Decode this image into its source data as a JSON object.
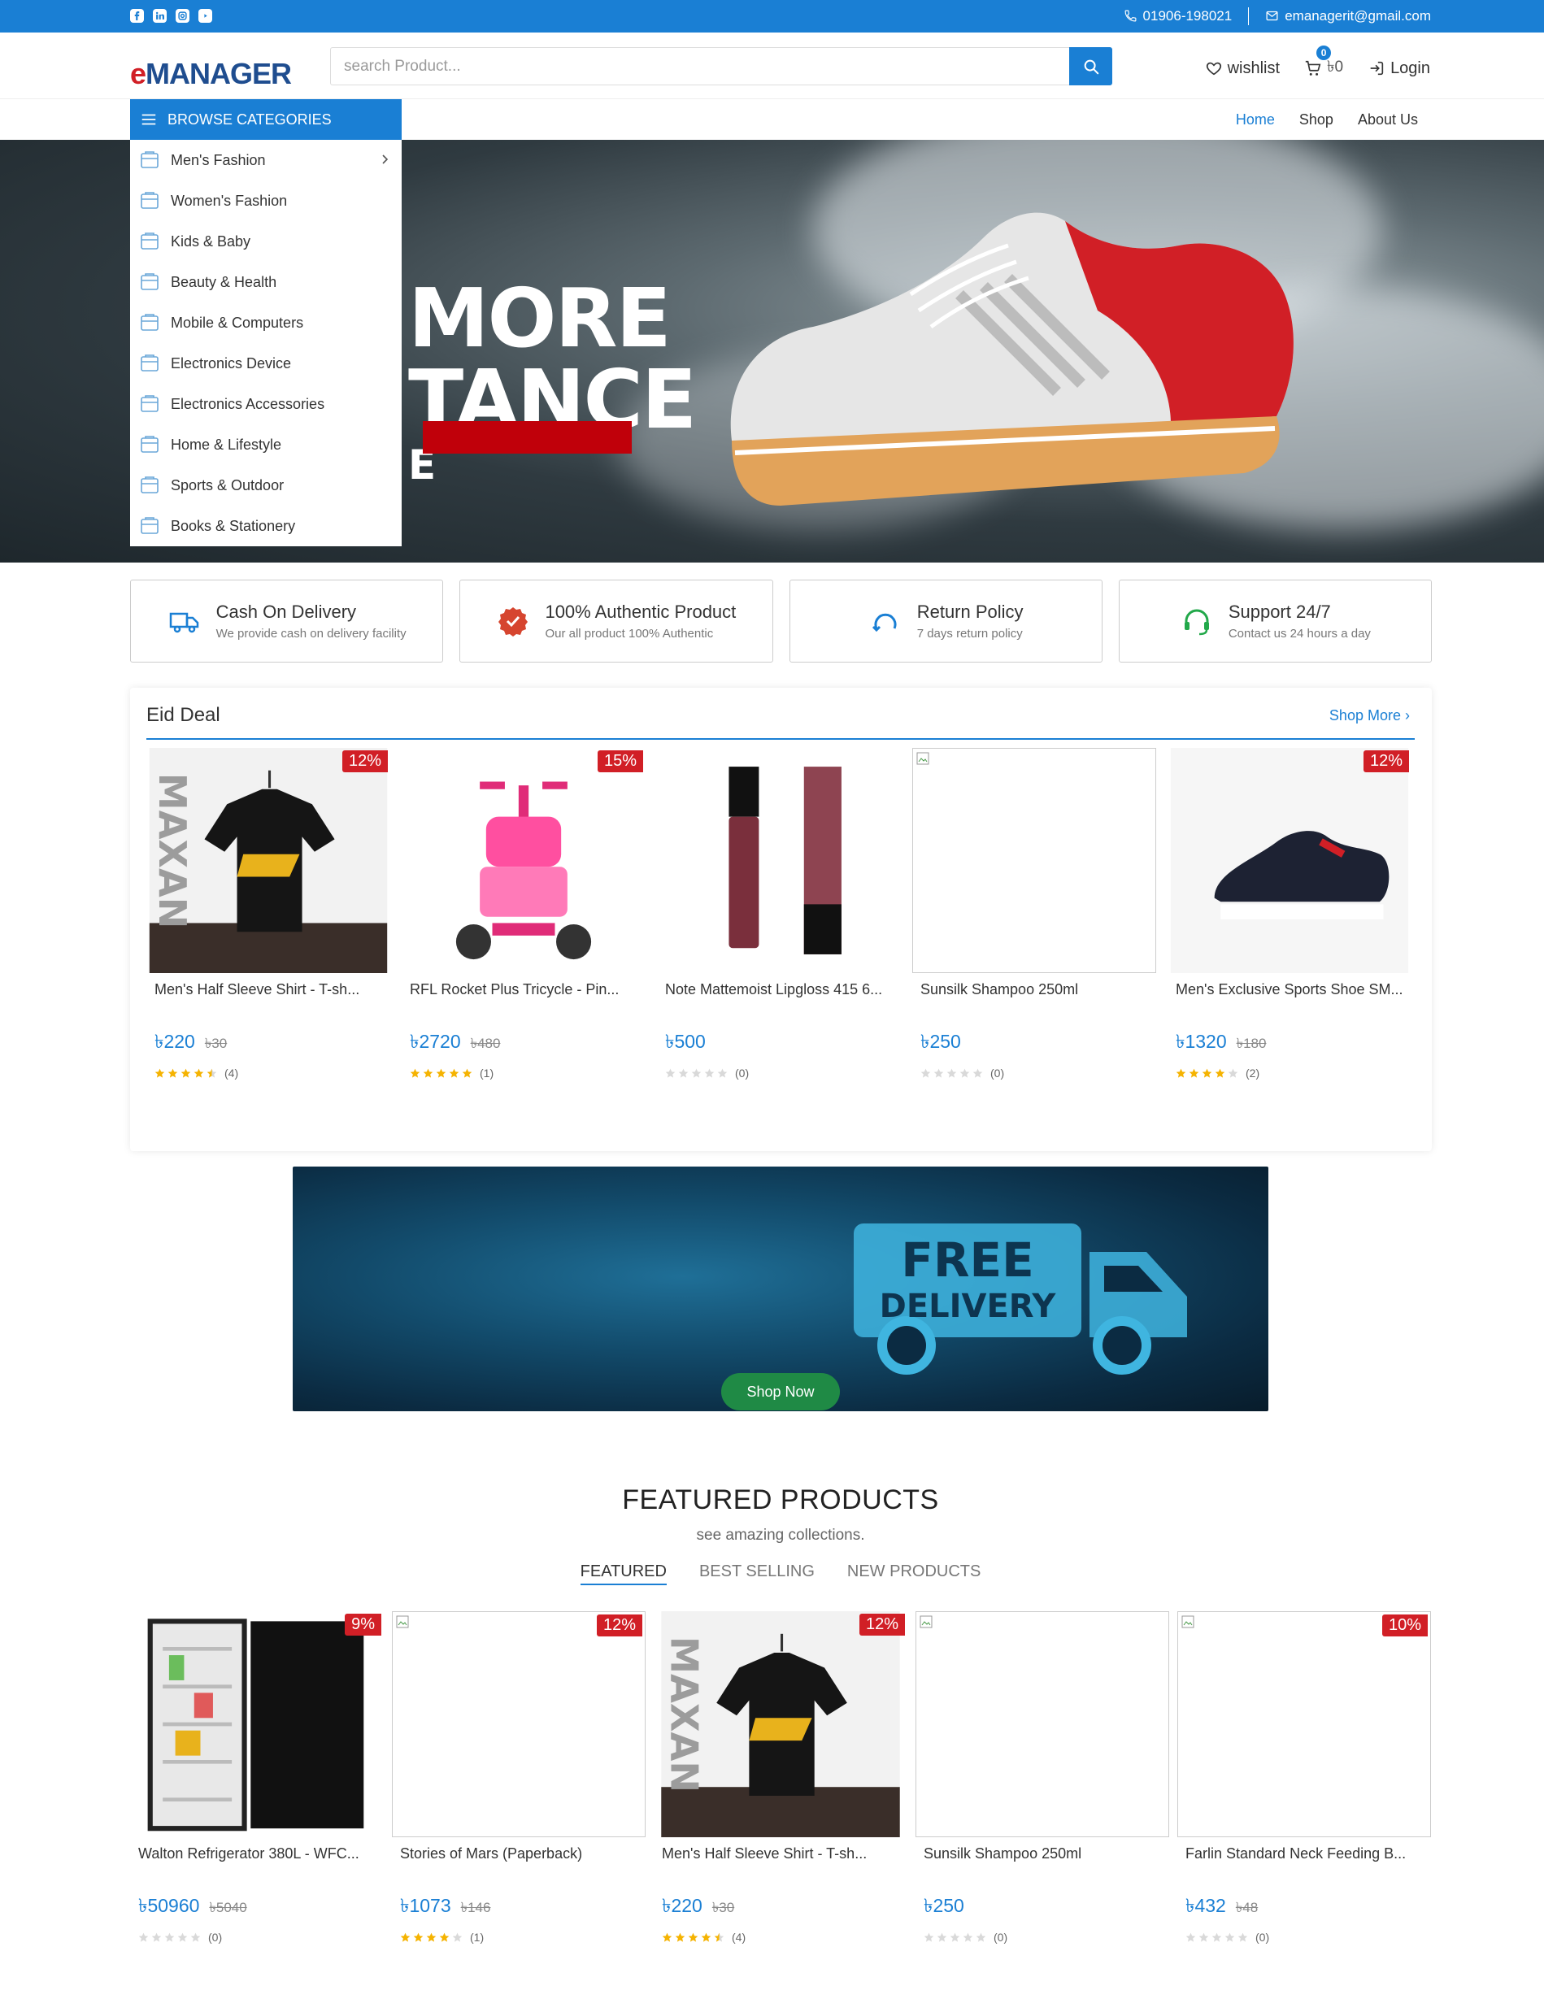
{
  "topbar": {
    "phone": "01906-198021",
    "email": "emanagerit@gmail.com",
    "social": [
      "facebook-icon",
      "linkedin-icon",
      "instagram-icon",
      "youtube-icon"
    ]
  },
  "header": {
    "logo_e": "e",
    "logo_rest": "MANAGER",
    "search_placeholder": "search Product...",
    "wishlist_label": "wishlist",
    "cart_count": "0",
    "cart_amount": "৳0",
    "login_label": "Login"
  },
  "browse": {
    "label": "BROWSE CATEGORIES"
  },
  "nav": {
    "home": "Home",
    "shop": "Shop",
    "about": "About Us"
  },
  "categories": [
    "Men's Fashion",
    "Women's Fashion",
    "Kids & Baby",
    "Beauty & Health",
    "Mobile & Computers",
    "Electronics Device",
    "Electronics Accessories",
    "Home & Lifestyle",
    "Sports & Outdoor",
    "Books & Stationery"
  ],
  "hero": {
    "line1": "MORE",
    "line2": "TANCE",
    "line3": "E"
  },
  "features": [
    {
      "title": "Cash On Delivery",
      "sub": "We provide cash on delivery facility"
    },
    {
      "title": "100% Authentic Product",
      "sub": "Our all product 100% Authentic"
    },
    {
      "title": "Return Policy",
      "sub": "7 days return policy"
    },
    {
      "title": "Support 24/7",
      "sub": "Contact us 24 hours a day"
    }
  ],
  "eid": {
    "title": "Eid Deal",
    "shop_more": "Shop More",
    "products": [
      {
        "name": "Men's Half Sleeve Shirt - T-sh...",
        "price": "৳220",
        "old": "৳30",
        "disc": "12%",
        "stars": 4.5,
        "count": "(4)"
      },
      {
        "name": "RFL Rocket Plus Tricycle - Pin...",
        "price": "৳2720",
        "old": "৳480",
        "disc": "15%",
        "stars": 5,
        "count": "(1)"
      },
      {
        "name": "Note Mattemoist Lipgloss 415 6...",
        "price": "৳500",
        "old": "",
        "disc": "",
        "stars": 0,
        "count": "(0)"
      },
      {
        "name": "Sunsilk Shampoo 250ml",
        "price": "৳250",
        "old": "",
        "disc": "",
        "stars": 0,
        "count": "(0)"
      },
      {
        "name": "Men's Exclusive Sports Shoe SM...",
        "price": "৳1320",
        "old": "৳180",
        "disc": "12%",
        "stars": 4,
        "count": "(2)"
      }
    ]
  },
  "promo": {
    "word1": "FREE",
    "word2": "DELIVERY",
    "button": "Shop Now"
  },
  "featured": {
    "title": "FEATURED PRODUCTS",
    "subtitle": "see amazing collections.",
    "tabs": [
      "FEATURED",
      "BEST SELLING",
      "NEW PRODUCTS"
    ],
    "products": [
      {
        "name": "Walton Refrigerator 380L - WFC...",
        "price": "৳50960",
        "old": "৳5040",
        "disc": "9%",
        "stars": 0,
        "count": "(0)"
      },
      {
        "name": "Stories of Mars (Paperback)",
        "price": "৳1073",
        "old": "৳146",
        "disc": "12%",
        "stars": 4,
        "count": "(1)"
      },
      {
        "name": "Men's Half Sleeve Shirt - T-sh...",
        "price": "৳220",
        "old": "৳30",
        "disc": "12%",
        "stars": 4.5,
        "count": "(4)"
      },
      {
        "name": "Sunsilk Shampoo 250ml",
        "price": "৳250",
        "old": "",
        "disc": "",
        "stars": 0,
        "count": "(0)"
      },
      {
        "name": "Farlin Standard Neck Feeding B...",
        "price": "৳432",
        "old": "৳48",
        "disc": "10%",
        "stars": 0,
        "count": "(0)"
      }
    ]
  },
  "colors": {
    "primary": "#1a7fd4",
    "sale": "#d11f26",
    "star": "#f5b301",
    "button_green": "#1f8a45"
  }
}
